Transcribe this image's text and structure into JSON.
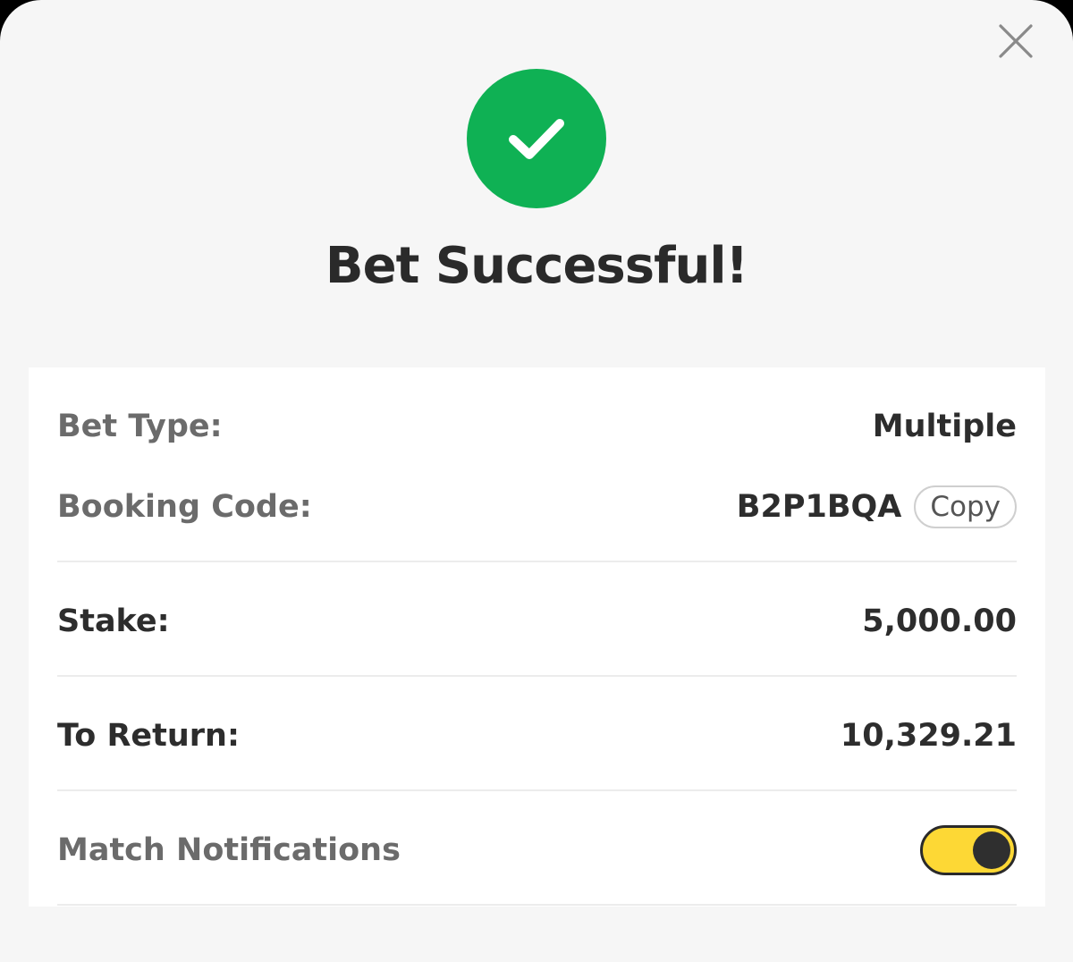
{
  "title": "Bet Successful!",
  "icons": {
    "close": "close-icon",
    "success": "checkmark-icon"
  },
  "colors": {
    "success_green": "#0fb154",
    "toggle_on": "#fdd835",
    "toggle_knob": "#2f2f2f"
  },
  "details": {
    "bet_type_label": "Bet Type:",
    "bet_type_value": "Multiple",
    "booking_code_label": "Booking Code:",
    "booking_code_value": "B2P1BQA",
    "copy_label": "Copy",
    "stake_label": "Stake:",
    "stake_value": "5,000.00",
    "to_return_label": "To Return:",
    "to_return_value": "10,329.21",
    "notifications_label": "Match Notifications",
    "notifications_on": true
  }
}
